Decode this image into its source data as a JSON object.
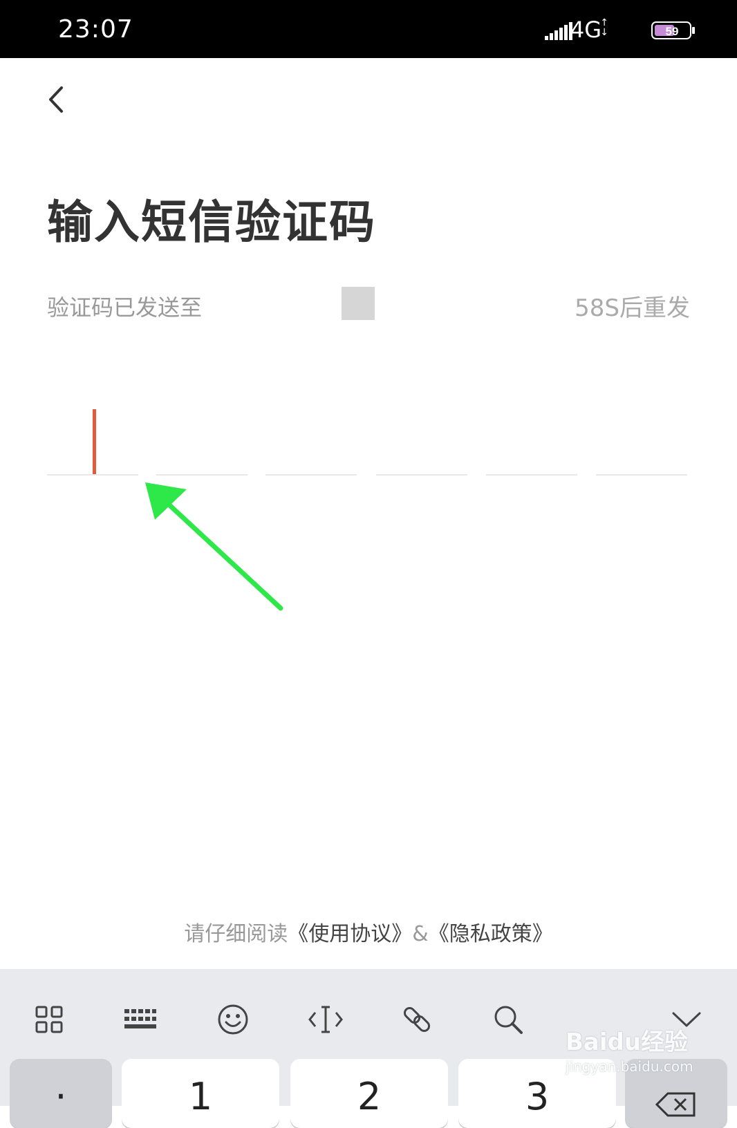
{
  "status_bar": {
    "time": "23:07",
    "network": "4G",
    "battery": "59"
  },
  "page": {
    "title": "输入短信验证码",
    "sent_to_label": "验证码已发送至",
    "resend_label": "58S后重发",
    "code_length": 6
  },
  "agreement": {
    "prefix": "请仔细阅读",
    "terms_link": "《使用协议》",
    "separator": "&",
    "privacy_link": "《隐私政策》"
  },
  "keyboard": {
    "tools": [
      "grid-icon",
      "keyboard-icon",
      "emoji-icon",
      "cursor-move-icon",
      "link-icon",
      "search-icon",
      "collapse-icon"
    ],
    "keys": [
      {
        "label": "·",
        "style": "gray"
      },
      {
        "label": "1",
        "style": "white"
      },
      {
        "label": "2",
        "style": "white"
      },
      {
        "label": "3",
        "style": "white"
      },
      {
        "label": "",
        "style": "gray"
      }
    ]
  },
  "annotation": {
    "arrow_color": "#2ee84a"
  },
  "watermark": {
    "brand": "Baidu经验",
    "domain": "jingyan.baidu.com"
  },
  "colors": {
    "cursor": "#e35b3d",
    "title": "#333333",
    "muted": "#999999"
  }
}
